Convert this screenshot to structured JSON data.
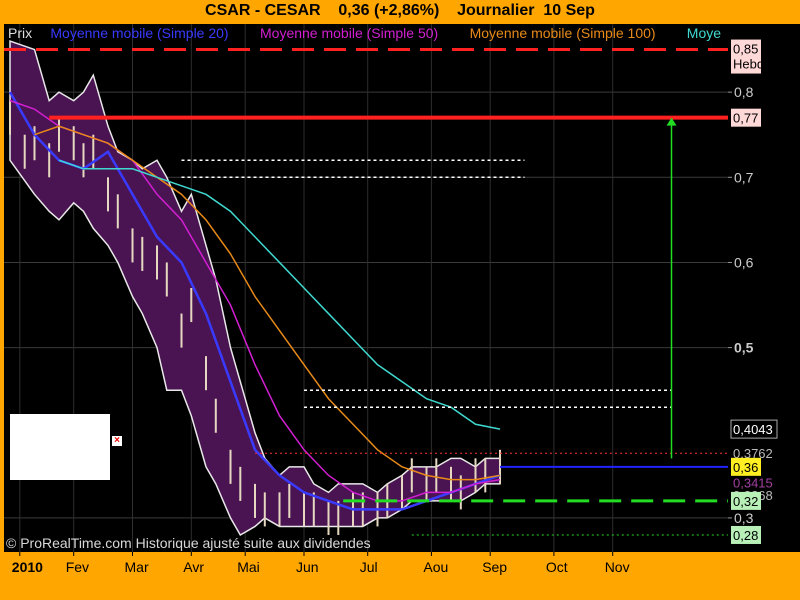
{
  "header": {
    "title": "CSAR - CESAR    0,36 (+2,86%)    Journalier  10 Sep"
  },
  "legend": {
    "items": [
      {
        "text": "Prix",
        "color": "#dddddd"
      },
      {
        "text": "Moyenne mobile (Simple 20)",
        "color": "#3a3aff"
      },
      {
        "text": "Moyenne mobile (Simple 50)",
        "color": "#d21fd2"
      },
      {
        "text": "Moyenne mobile (Simple 100)",
        "color": "#e88a18"
      },
      {
        "text": "Moye",
        "color": "#3fd9d0"
      }
    ]
  },
  "copyright": "© ProRealTime.com Historique ajusté suite aux dividendes",
  "chart_data": {
    "type": "line",
    "title": "CSAR - CESAR    0,36 (+2,86%)    Journalier  10 Sep",
    "ylim": [
      0.26,
      0.88
    ],
    "xlim": [
      0,
      120
    ],
    "y_ticks": [
      "0,8",
      "0,7",
      "0,6",
      "0,5",
      "0,3"
    ],
    "y_tick_values": [
      0.8,
      0.7,
      0.6,
      0.5,
      0.3
    ],
    "x_ticks": [
      "2010",
      "Fev",
      "Mar",
      "Avr",
      "Mai",
      "Jun",
      "Jul",
      "Aou",
      "Sep",
      "Oct",
      "Nov"
    ],
    "x_tick_positions": [
      2,
      13,
      25,
      37,
      48,
      60,
      73,
      86,
      98,
      111,
      123
    ],
    "series": [
      {
        "name": "Prix",
        "color": "#dddddd",
        "x": [
          0,
          3,
          5,
          8,
          10,
          13,
          15,
          17,
          20,
          22,
          25,
          27,
          30,
          32,
          35,
          37,
          40,
          42,
          45,
          47,
          50,
          52,
          55,
          57,
          60,
          62,
          65,
          67,
          70,
          72,
          75,
          77,
          80,
          82,
          85,
          87,
          90,
          92,
          95,
          97,
          100
        ],
        "values": [
          0.77,
          0.73,
          0.74,
          0.72,
          0.75,
          0.74,
          0.72,
          0.73,
          0.68,
          0.66,
          0.62,
          0.61,
          0.6,
          0.58,
          0.52,
          0.55,
          0.47,
          0.42,
          0.36,
          0.34,
          0.32,
          0.31,
          0.31,
          0.32,
          0.31,
          0.31,
          0.3,
          0.3,
          0.31,
          0.31,
          0.31,
          0.32,
          0.33,
          0.35,
          0.34,
          0.35,
          0.34,
          0.33,
          0.35,
          0.35,
          0.36
        ]
      },
      {
        "name": "Moyenne mobile (Simple 20)",
        "color": "#3a3aff",
        "x": [
          0,
          5,
          10,
          15,
          20,
          25,
          30,
          35,
          40,
          45,
          50,
          55,
          60,
          65,
          70,
          75,
          80,
          85,
          90,
          95,
          100
        ],
        "values": [
          0.8,
          0.75,
          0.72,
          0.71,
          0.73,
          0.68,
          0.63,
          0.6,
          0.54,
          0.46,
          0.38,
          0.35,
          0.33,
          0.32,
          0.31,
          0.31,
          0.31,
          0.32,
          0.33,
          0.34,
          0.35
        ]
      },
      {
        "name": "Moyenne mobile (Simple 50)",
        "color": "#d21fd2",
        "x": [
          0,
          5,
          10,
          15,
          20,
          25,
          30,
          35,
          40,
          45,
          50,
          55,
          60,
          65,
          70,
          75,
          80,
          85,
          90,
          95,
          100
        ],
        "values": [
          0.79,
          0.78,
          0.76,
          0.75,
          0.74,
          0.72,
          0.68,
          0.65,
          0.6,
          0.55,
          0.48,
          0.42,
          0.38,
          0.35,
          0.33,
          0.32,
          0.32,
          0.33,
          0.33,
          0.34,
          0.345
        ]
      },
      {
        "name": "Moyenne mobile (Simple 100)",
        "color": "#e88a18",
        "x": [
          5,
          10,
          15,
          20,
          25,
          30,
          35,
          40,
          45,
          50,
          55,
          60,
          65,
          70,
          75,
          80,
          85,
          90,
          95,
          100
        ],
        "values": [
          0.75,
          0.76,
          0.75,
          0.74,
          0.72,
          0.7,
          0.68,
          0.65,
          0.61,
          0.56,
          0.52,
          0.48,
          0.44,
          0.41,
          0.38,
          0.36,
          0.35,
          0.345,
          0.345,
          0.35
        ]
      },
      {
        "name": "Moye",
        "color": "#3fd9d0",
        "x": [
          10,
          15,
          20,
          25,
          30,
          35,
          40,
          45,
          50,
          55,
          60,
          65,
          70,
          75,
          80,
          85,
          90,
          95,
          100
        ],
        "values": [
          0.72,
          0.71,
          0.71,
          0.71,
          0.7,
          0.69,
          0.68,
          0.66,
          0.63,
          0.6,
          0.57,
          0.54,
          0.51,
          0.48,
          0.46,
          0.44,
          0.43,
          0.41,
          0.4043
        ]
      }
    ],
    "bollinger": {
      "x": [
        0,
        5,
        8,
        10,
        13,
        15,
        17,
        20,
        22,
        25,
        27,
        30,
        32,
        35,
        37,
        40,
        42,
        45,
        47,
        50,
        52,
        55,
        57,
        60,
        62,
        65,
        67,
        70,
        72,
        75,
        77,
        80,
        82,
        85,
        87,
        90,
        92,
        95,
        97,
        100
      ],
      "upper": [
        0.86,
        0.85,
        0.79,
        0.8,
        0.79,
        0.8,
        0.82,
        0.76,
        0.73,
        0.72,
        0.71,
        0.72,
        0.7,
        0.66,
        0.68,
        0.62,
        0.58,
        0.5,
        0.46,
        0.4,
        0.37,
        0.35,
        0.36,
        0.36,
        0.34,
        0.33,
        0.34,
        0.34,
        0.34,
        0.33,
        0.34,
        0.35,
        0.36,
        0.36,
        0.36,
        0.37,
        0.37,
        0.36,
        0.37,
        0.37
      ],
      "lower": [
        0.72,
        0.68,
        0.66,
        0.65,
        0.67,
        0.66,
        0.64,
        0.62,
        0.6,
        0.56,
        0.54,
        0.5,
        0.45,
        0.45,
        0.42,
        0.36,
        0.34,
        0.3,
        0.28,
        0.29,
        0.3,
        0.29,
        0.29,
        0.29,
        0.29,
        0.29,
        0.29,
        0.29,
        0.29,
        0.3,
        0.3,
        0.31,
        0.32,
        0.32,
        0.32,
        0.32,
        0.32,
        0.33,
        0.34,
        0.34
      ]
    },
    "horizontal_lines": [
      {
        "name": "hebdo-resistance",
        "value": 0.85,
        "color": "#ff2020",
        "style": "dashed-long",
        "label": "0,85",
        "sublabel": "Hebdo"
      },
      {
        "name": "resistance-077",
        "value": 0.77,
        "color": "#ff2020",
        "style": "solid-thick",
        "label": "0,77"
      },
      {
        "name": "support-032",
        "value": 0.32,
        "color": "#22dd22",
        "style": "dashed-long",
        "label": "0,32"
      },
      {
        "name": "support-028",
        "value": 0.28,
        "color": "#22dd22",
        "style": "dotted",
        "label": "0,28"
      },
      {
        "name": "current-036",
        "value": 0.36,
        "color": "#2222ff",
        "style": "solid",
        "label": "0,36"
      },
      {
        "name": "ma-line-04043",
        "value": 0.4043,
        "color": "#555555",
        "style": "none",
        "label": "0,4043"
      }
    ],
    "overlapping_axis_labels": [
      "0,3762",
      "0,3415",
      "0,3268"
    ],
    "target_arrow": {
      "from": 0.37,
      "to": 0.77,
      "color": "#22dd22"
    },
    "grid": true
  }
}
